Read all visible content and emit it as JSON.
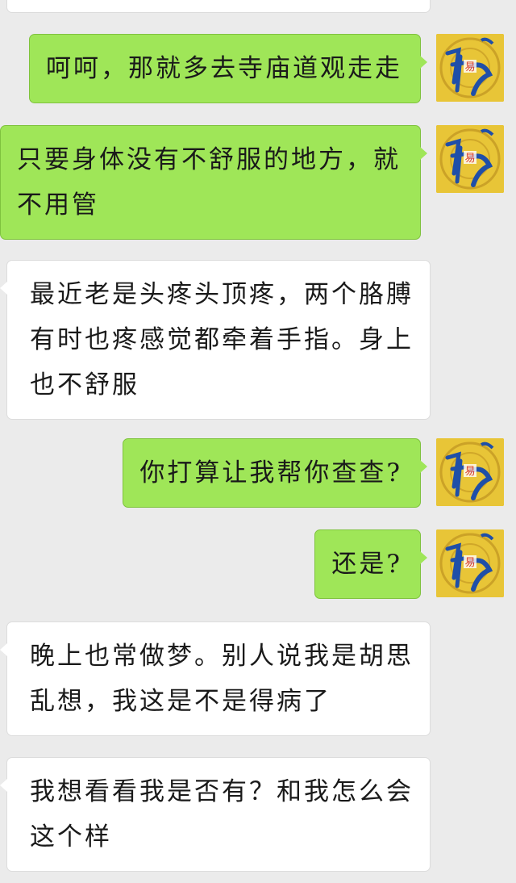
{
  "conversation": {
    "messages": [
      {
        "sender": "me",
        "text": "呵呵，那就多去寺庙道观走走"
      },
      {
        "sender": "me",
        "text": "只要身体没有不舒服的地方，就不用管"
      },
      {
        "sender": "other",
        "text": "最近老是头疼头顶疼，两个胳膊有时也疼感觉都牵着手指。身上也不舒服"
      },
      {
        "sender": "me",
        "text": "你打算让我帮你查查?"
      },
      {
        "sender": "me",
        "text": "还是?"
      },
      {
        "sender": "other",
        "text": "晚上也常做梦。别人说我是胡思乱想，我这是不是得病了"
      },
      {
        "sender": "other",
        "text": "我想看看我是否有？和我怎么会这个样"
      }
    ]
  },
  "avatar": {
    "icon": "fengshui-logo-icon",
    "badge_text": "易",
    "colors": {
      "bg": "#e8c537",
      "brush": "#1f4fa8",
      "badge": "#d83a2a"
    }
  },
  "colors": {
    "background": "#ebebeb",
    "sent_bubble": "#9fe658",
    "received_bubble": "#ffffff"
  }
}
